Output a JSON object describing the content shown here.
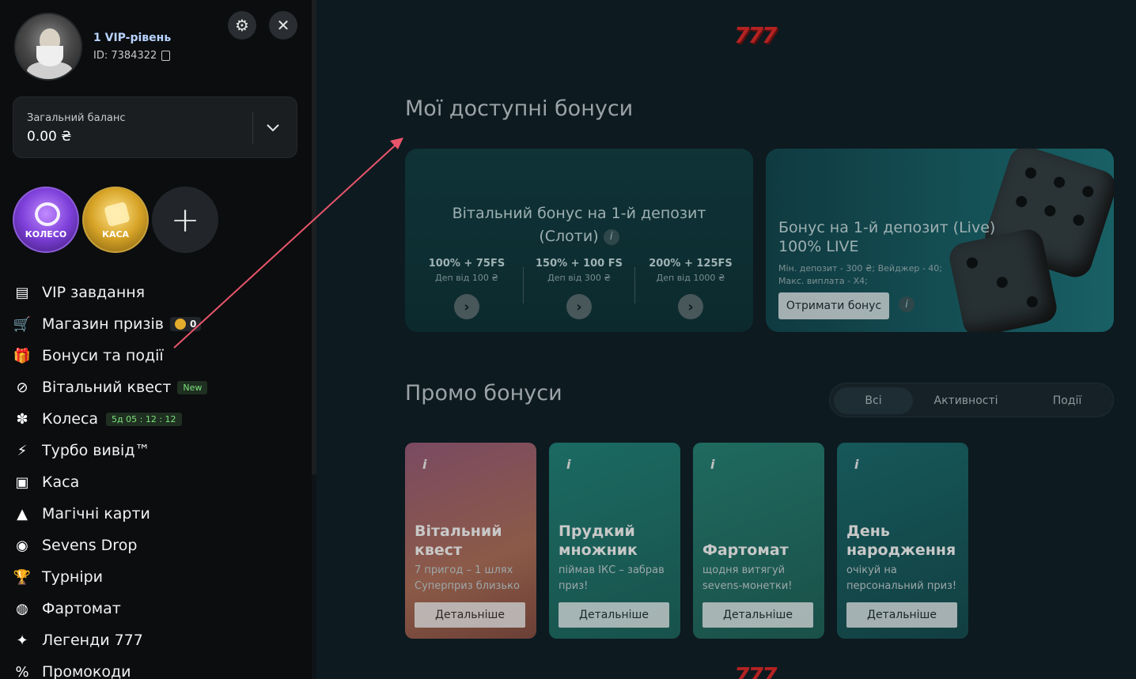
{
  "user": {
    "vip_level": "1 VIP-рівень",
    "id_label": "ID: 7384322"
  },
  "balance": {
    "label": "Загальний баланс",
    "value": "0.00 ₴"
  },
  "quick_actions": {
    "wheel_label": "КОЛЕСО",
    "cash_label": "КАСА",
    "add_symbol": "+"
  },
  "menu": {
    "items": [
      {
        "label": "VIP завдання",
        "icon": "vip-tasks-icon",
        "glyph": "▤"
      },
      {
        "label": "Магазин призів",
        "icon": "cart-icon",
        "glyph": "🛒"
      },
      {
        "label": "Бонуси та події",
        "icon": "gift-icon",
        "glyph": "🎁"
      },
      {
        "label": "Вітальний квест",
        "icon": "compass-icon",
        "glyph": "⊘"
      },
      {
        "label": "Колеса",
        "icon": "wheel-icon",
        "glyph": "✽"
      },
      {
        "label": "Турбо вивід™",
        "icon": "lightning-icon",
        "glyph": "⚡"
      },
      {
        "label": "Каса",
        "icon": "wallet-icon",
        "glyph": "▣"
      },
      {
        "label": "Магічні карти",
        "icon": "wizard-hat-icon",
        "glyph": "▲"
      },
      {
        "label": "Sevens Drop",
        "icon": "drop-icon",
        "glyph": "◉"
      },
      {
        "label": "Турніри",
        "icon": "trophy-icon",
        "glyph": "🏆"
      },
      {
        "label": "Фартомат",
        "icon": "fartomat-icon",
        "glyph": "◍"
      },
      {
        "label": "Легенди 777",
        "icon": "laurel-icon",
        "glyph": "✦"
      },
      {
        "label": "Промокоди",
        "icon": "promo-icon",
        "glyph": "%"
      }
    ],
    "shop_coins": "0",
    "quest_badge": "New",
    "wheels_timer": "5д 05 : 12 : 12"
  },
  "main": {
    "logo": "777",
    "my_bonuses_title": "Мої доступні бонуси",
    "welcome_card": {
      "title_line1": "Вітальний бонус на 1-й депозит",
      "title_line2": "(Слоти)",
      "info": "i",
      "tiers": [
        {
          "main": "100% + 75FS",
          "sub": "Деп від 100 ₴"
        },
        {
          "main": "150% + 100 FS",
          "sub": "Деп від 300 ₴"
        },
        {
          "main": "200% + 125FS",
          "sub": "Деп від 1000 ₴"
        }
      ]
    },
    "live_card": {
      "title_line1": "Бонус на 1-й депозит (Live)",
      "title_line2": "100% LIVE",
      "sub_line1": "Мін. депозит - 300 ₴; Вейджер - 40;",
      "sub_line2": "Макс. виплата - X4;",
      "button": "Отримати бонус",
      "info": "i"
    },
    "promo_title": "Промо бонуси",
    "filters": [
      "Всі",
      "Активності",
      "Події"
    ],
    "promos": [
      {
        "title": "Вітальний квест",
        "sub": "7 пригод – 1 шлях Суперприз близько",
        "button": "Детальніше",
        "info": "i"
      },
      {
        "title": "Прудкий множник",
        "sub": "піймав ІКС – забрав приз!",
        "button": "Детальніше",
        "info": "i"
      },
      {
        "title": "Фартомат",
        "sub": "щодня витягуй sevens-монетки!",
        "button": "Детальніше",
        "info": "i"
      },
      {
        "title": "День народження",
        "sub": "очікуй на персональний приз!",
        "button": "Детальніше",
        "info": "i"
      }
    ]
  },
  "colors": {
    "annotation_arrow": "#e8556b",
    "logo_red": "#b42222",
    "new_badge": "#7be37b"
  }
}
